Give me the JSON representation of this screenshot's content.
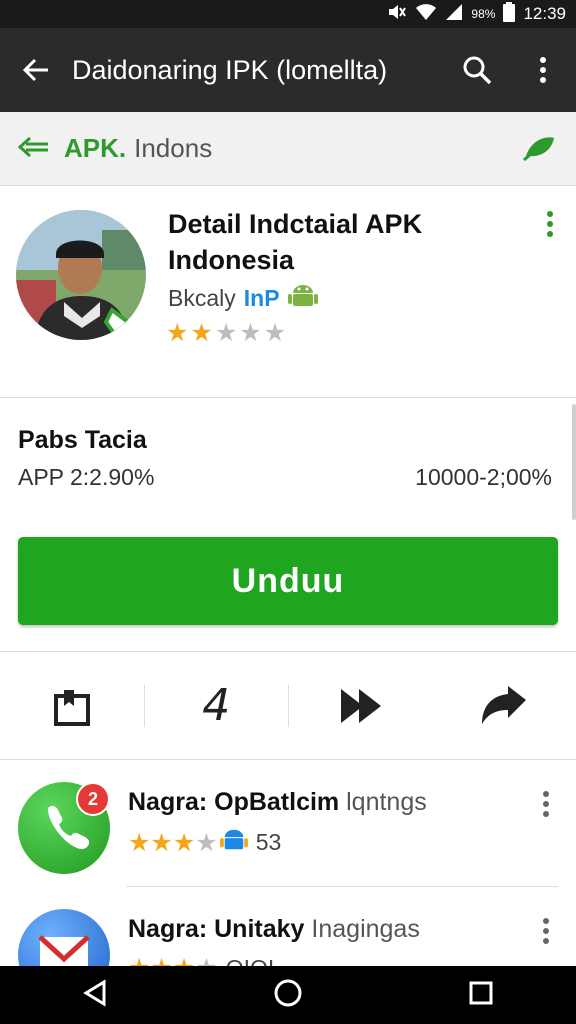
{
  "status_bar": {
    "time": "12:39",
    "battery": "98%",
    "icons": [
      "mute-icon",
      "wifi-icon",
      "signal-icon",
      "battery-icon"
    ]
  },
  "app_bar": {
    "title": "Daidonaring IPK (lomellta)",
    "icons": [
      "back-arrow-icon",
      "search-icon",
      "overflow-menu-icon"
    ]
  },
  "sub_bar": {
    "brand": "APK.",
    "crumb": "Indons",
    "icons": [
      "green-back-arrow-icon",
      "leaf-icon"
    ]
  },
  "app": {
    "name_line1": "Detail Indctaial APK",
    "name_line2": "Indonesia",
    "developer": "Bkcaly",
    "developer_tag": "InP",
    "rating": 2,
    "rating_max": 5
  },
  "info": {
    "title": "Pabs Tacia",
    "left_value": "APP 2:2.90%",
    "right_value": "10000-2;00%",
    "install_label": "Unduu"
  },
  "actions": {
    "count": "4",
    "icons": [
      "bookmark-icon",
      "fast-forward-icon",
      "share-icon"
    ]
  },
  "list": [
    {
      "title_bold": "Nagra: OpBatlcim",
      "title_rest": "lqntngs",
      "rating": 3,
      "count": "53",
      "badge": "2"
    },
    {
      "title_bold": "Nagra: Unitaky",
      "title_rest": "Inagingas",
      "rating": 3,
      "count": "OIOI"
    }
  ],
  "colors": {
    "accent": "#1fa51f",
    "toolbar": "#2b2b2b",
    "star": "#f3a619",
    "badge": "#e53935",
    "link": "#1e88e5"
  }
}
